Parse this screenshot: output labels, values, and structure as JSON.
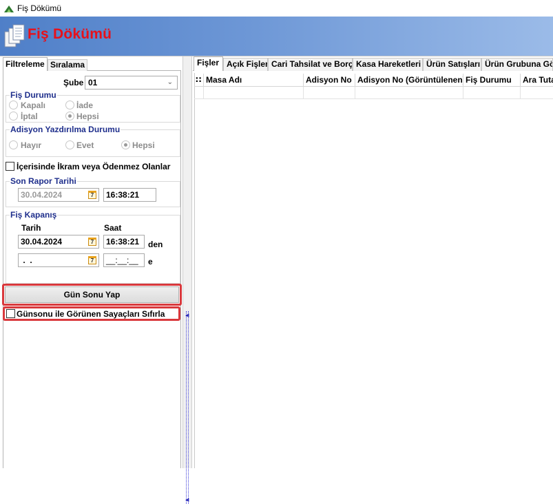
{
  "window": {
    "title": "Fiş Dökümü"
  },
  "header": {
    "title": "Fiş Dökümü"
  },
  "left_tabs": [
    {
      "label": "Filtreleme",
      "active": true
    },
    {
      "label": "Sıralama",
      "active": false
    }
  ],
  "filters": {
    "sube_label": "Şube",
    "sube_value": "01",
    "fis_durumu": {
      "legend": "Fiş Durumu",
      "options": [
        "Kapalı",
        "İade",
        "İptal",
        "Hepsi"
      ],
      "selected": "Hepsi"
    },
    "adisyon_yazdirilma": {
      "legend": "Adisyon Yazdırılma Durumu",
      "options": [
        "Hayır",
        "Evet",
        "Hepsi"
      ],
      "selected": "Hepsi"
    },
    "ikram_checkbox": "İçerisinde İkram veya Ödenmez Olanlar",
    "son_rapor": {
      "legend": "Son Rapor Tarihi",
      "date": "30.04.2024",
      "time": "16:38:21"
    },
    "fis_kapanis": {
      "legend": "Fiş Kapanış",
      "tarih_label": "Tarih",
      "saat_label": "Saat",
      "start_date": "30.04.2024",
      "start_time": "16:38:21",
      "start_suffix": "den",
      "end_date": " .  .",
      "end_time": "__:__:__",
      "end_suffix": "e"
    },
    "gun_sonu_button": "Gün Sonu Yap",
    "sayac_checkbox": "Günsonu ile Görünen Sayaçları Sıfırla"
  },
  "right_tabs": [
    {
      "label": "Fişler",
      "active": true
    },
    {
      "label": "Açık Fişler",
      "active": false
    },
    {
      "label": "Cari Tahsilat ve Borç",
      "active": false
    },
    {
      "label": "Kasa Hareketleri",
      "active": false
    },
    {
      "label": "Ürün Satışları",
      "active": false
    },
    {
      "label": "Ürün Grubuna Gör",
      "active": false
    }
  ],
  "grid": {
    "indicator": "∷",
    "columns": [
      "Masa Adı",
      "Adisyon No",
      "Adisyon No (Görüntülenen)",
      "Fiş Durumu",
      "Ara Tuta"
    ]
  },
  "colors": {
    "header_title": "#e8101a",
    "legend_text": "#1f2f8c",
    "highlight": "#d9383c",
    "banner_start": "#4f7fc8",
    "banner_end": "#9bbbe8"
  }
}
